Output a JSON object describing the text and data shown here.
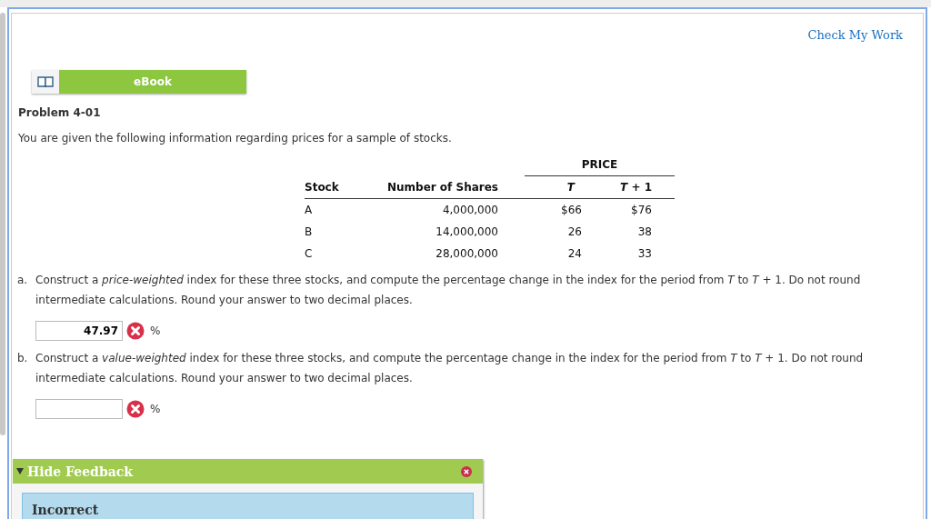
{
  "check_my_work": "Check My Work",
  "ebook": {
    "label": "eBook"
  },
  "problem_title": "Problem 4-01",
  "intro": "You are given the following information regarding prices for a sample of stocks.",
  "table": {
    "group_header": "PRICE",
    "columns": [
      "Stock",
      "Number of Shares",
      "*T*",
      "*T* + 1"
    ],
    "rows": [
      [
        "A",
        "4,000,000",
        "$66",
        "$76"
      ],
      [
        "B",
        "14,000,000",
        "26",
        "38"
      ],
      [
        "C",
        "28,000,000",
        "24",
        "33"
      ]
    ]
  },
  "questions": [
    {
      "letter": "a.",
      "text": "Construct a *price-weighted* index for these three stocks, and compute the percentage change in the index for the period from *T* to *T* + 1. Do not round intermediate calculations. Round your answer to two decimal places.",
      "answer": "47.97",
      "incorrect": true,
      "unit": "%"
    },
    {
      "letter": "b.",
      "text": "Construct a *value-weighted* index for these three stocks, and compute the percentage change in the index for the period from *T* to *T* + 1. Do not round intermediate calculations. Round your answer to two decimal places.",
      "incorrect": true,
      "unit": "%"
    }
  ],
  "feedback": {
    "title": "Hide Feedback",
    "expanded": true,
    "status": "Incorrect"
  }
}
